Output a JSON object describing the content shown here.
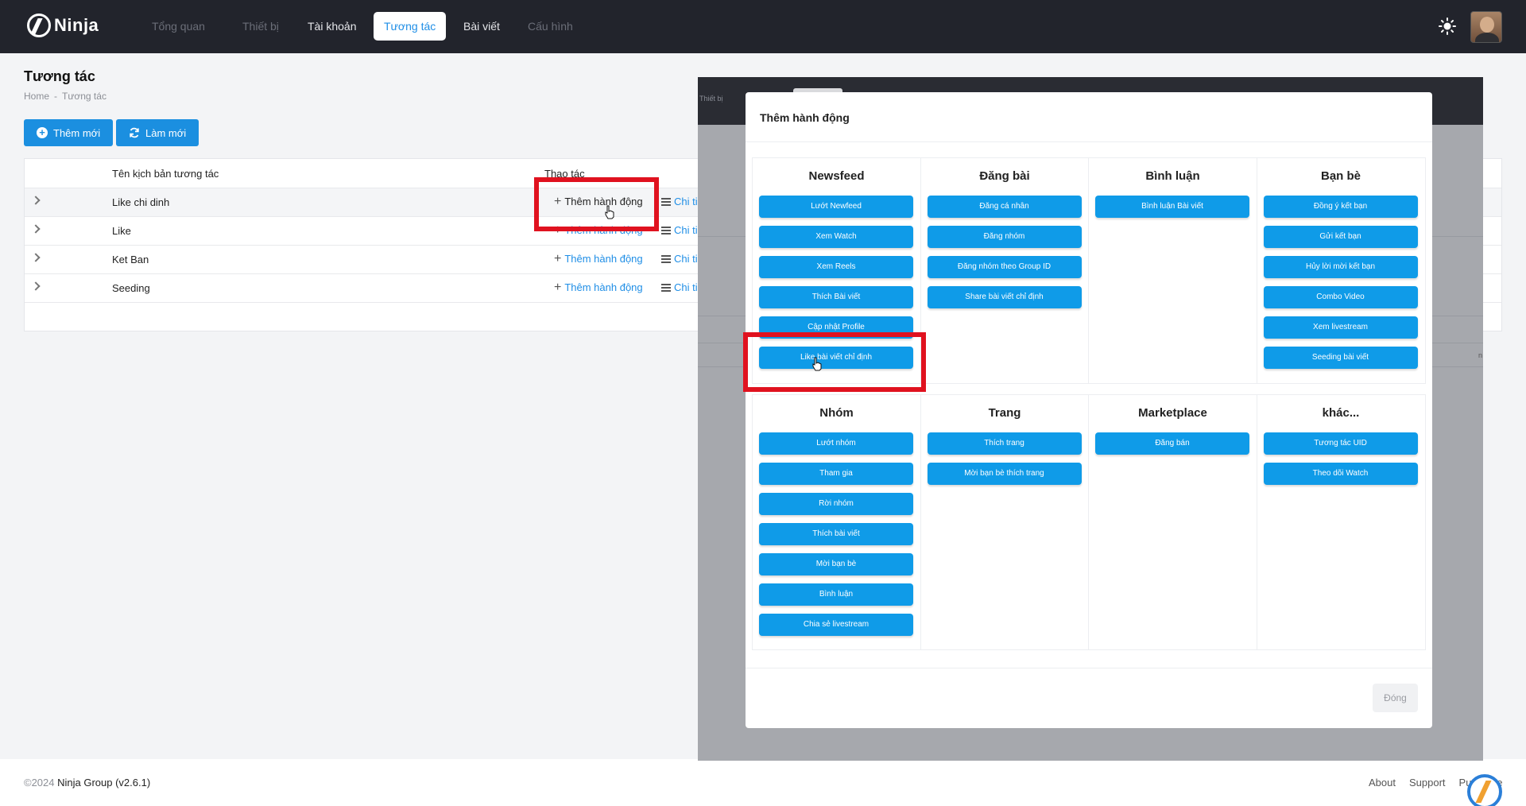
{
  "app": {
    "logo_text": "Ninja",
    "nav": [
      {
        "label": "Tổng quan",
        "state": "dim"
      },
      {
        "label": "Thiết bị",
        "state": "dim"
      },
      {
        "label": "Tài khoản",
        "state": "normal"
      },
      {
        "label": "Tương tác",
        "state": "active"
      },
      {
        "label": "Bài viết",
        "state": "normal"
      },
      {
        "label": "Cấu hình",
        "state": "dim"
      }
    ]
  },
  "page": {
    "title": "Tương tác",
    "breadcrumb": [
      "Home",
      "-",
      "Tương tác"
    ],
    "add_button": "Thêm mới",
    "refresh_button": "Làm mới"
  },
  "table": {
    "columns": [
      "Tên kịch bản tương tác",
      "Thao tác"
    ],
    "rows": [
      {
        "name": "Like chi dinh",
        "action": "Thêm hành động",
        "detail": "Chi ti"
      },
      {
        "name": "Like",
        "action": "Thêm hành động",
        "detail": "Chi ti"
      },
      {
        "name": "Ket Ban",
        "action": "Thêm hành động",
        "detail": "Chi ti"
      },
      {
        "name": "Seeding",
        "action": "Thêm hành động",
        "detail": "Chi ti"
      }
    ]
  },
  "overlay": {
    "ghost_nav": "Thiết bị",
    "ghost_number": "n"
  },
  "modal": {
    "title": "Thêm hành động",
    "close_button": "Đóng",
    "top_groups": [
      {
        "title": "Newsfeed",
        "actions": [
          "Lướt Newfeed",
          "Xem Watch",
          "Xem Reels",
          "Thích Bài viết",
          "Cập nhật Profile",
          "Like bài viết chỉ định"
        ]
      },
      {
        "title": "Đăng bài",
        "actions": [
          "Đăng cá nhân",
          "Đăng nhóm",
          "Đăng nhóm theo Group ID",
          "Share bài viết chỉ định"
        ]
      },
      {
        "title": "Bình luận",
        "actions": [
          "Bình luận Bài viết"
        ]
      },
      {
        "title": "Bạn bè",
        "actions": [
          "Đồng ý kết bạn",
          "Gửi kết bạn",
          "Hủy lời mời kết bạn",
          "Combo Video",
          "Xem livestream",
          "Seeding bài viết"
        ]
      }
    ],
    "bottom_groups": [
      {
        "title": "Nhóm",
        "actions": [
          "Lướt nhóm",
          "Tham gia",
          "Rời nhóm",
          "Thích bài viết",
          "Mời bạn bè",
          "Bình luận",
          "Chia sẻ livestream"
        ]
      },
      {
        "title": "Trang",
        "actions": [
          "Thích trang",
          "Mời bạn bè thích trang"
        ]
      },
      {
        "title": "Marketplace",
        "actions": [
          "Đăng bán"
        ]
      },
      {
        "title": "khác...",
        "actions": [
          "Tương tác UID",
          "Theo dõi Watch"
        ]
      }
    ]
  },
  "footer": {
    "year": "©2024",
    "company": "Ninja Group (v2.6.1)",
    "links": [
      "About",
      "Support",
      "Purchase"
    ]
  },
  "colors": {
    "header_bg": "#22242c",
    "accent": "#1b8fe0",
    "action_button": "#0f9be8",
    "highlight_box": "#e0121f"
  }
}
